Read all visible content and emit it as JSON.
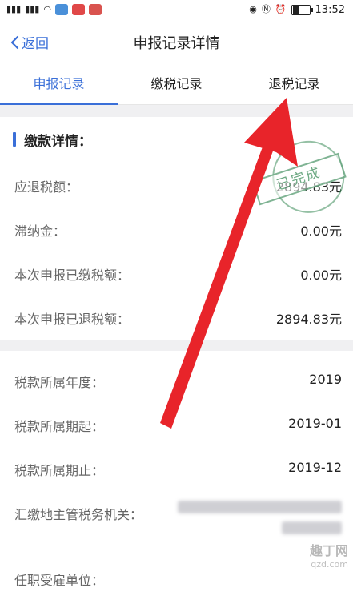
{
  "status_bar": {
    "left_indicators": [
      "46",
      "46",
      "wifi",
      "app"
    ],
    "time": "13:52",
    "battery_level_percent": 45
  },
  "header": {
    "back_label": "返回",
    "title": "申报记录详情"
  },
  "tabs": [
    {
      "label": "申报记录",
      "active": true
    },
    {
      "label": "缴税记录",
      "active": false
    },
    {
      "label": "退税记录",
      "active": false
    }
  ],
  "section": {
    "title": "缴款详情："
  },
  "payment_rows": [
    {
      "label": "应退税额：",
      "value": "2894.83元"
    },
    {
      "label": "滞纳金：",
      "value": "0.00元"
    },
    {
      "label": "本次申报已缴税额：",
      "value": "0.00元"
    },
    {
      "label": "本次申报已退税额：",
      "value": "2894.83元"
    }
  ],
  "period_rows": [
    {
      "label": "税款所属年度：",
      "value": "2019"
    },
    {
      "label": "税款所属期起：",
      "value": "2019-01"
    },
    {
      "label": "税款所属期止：",
      "value": "2019-12"
    },
    {
      "label": "汇缴地主管税务机关：",
      "value": ""
    },
    {
      "label": "任职受雇单位：",
      "value": ""
    }
  ],
  "stamp": {
    "text": "已完成"
  },
  "watermark": {
    "cn": "趣丁网",
    "en": "qzd.com"
  },
  "colors": {
    "accent": "#3a6fd8",
    "arrow": "#e8242a",
    "stamp": "#3c8c5a"
  }
}
